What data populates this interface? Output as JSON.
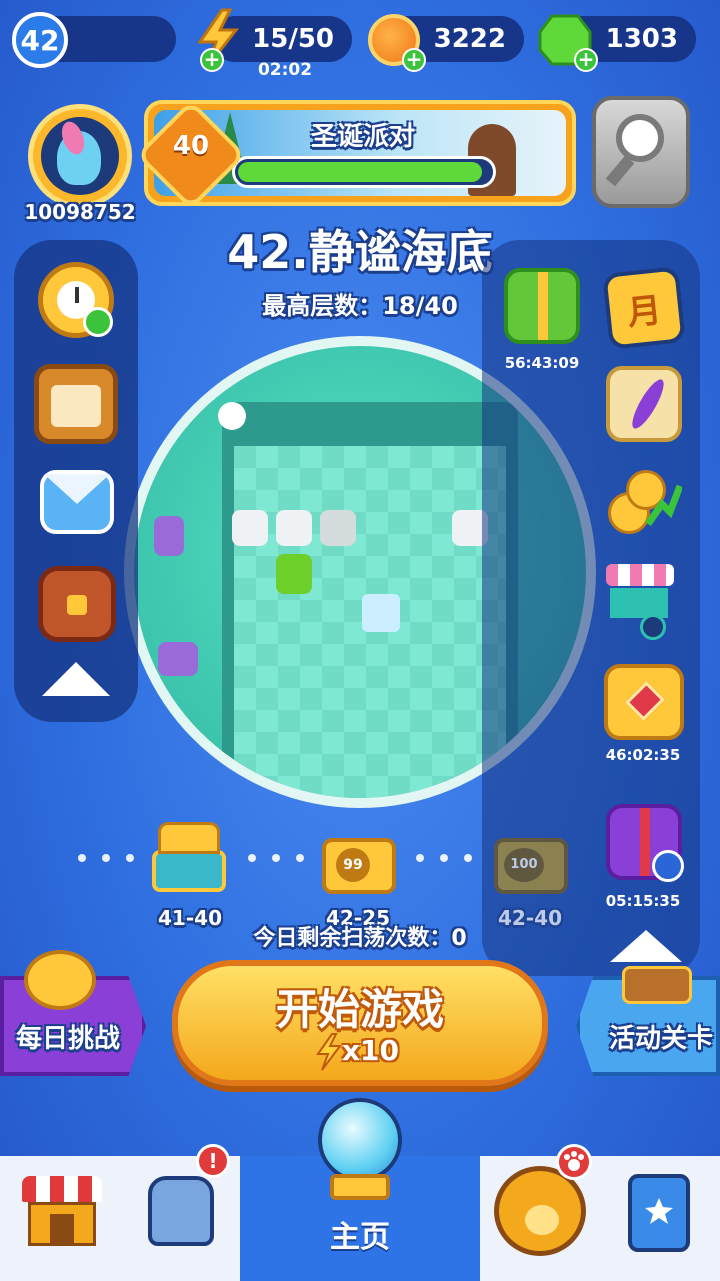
{
  "status_bar": {
    "player_level": "42",
    "energy": "15/50",
    "energy_timer": "02:02",
    "coins": "3222",
    "gems": "1303"
  },
  "player": {
    "id": "10098752"
  },
  "event_banner": {
    "level": "40",
    "title": "圣诞派对",
    "progress": 0.95
  },
  "stage": {
    "title": "42.静谧海底",
    "best_floor": "最高层数：18/40"
  },
  "left_menu": {
    "items": [
      "speed-up-stopwatch",
      "pet-board",
      "mail",
      "backpack"
    ]
  },
  "right_menu": {
    "gift_timer": "56:43:09",
    "monthly_label": "月",
    "chest_timer": "46:02:35",
    "gift_box_timer": "05:15:35"
  },
  "rewards": {
    "chests": [
      {
        "label": "41-40",
        "badge": ""
      },
      {
        "label": "42-25",
        "badge": "99"
      },
      {
        "label": "42-40",
        "badge": "100"
      }
    ],
    "sweeps_remaining": "今日剩余扫荡次数：0"
  },
  "buttons": {
    "daily_challenge": "每日挑战",
    "start_game": "开始游戏",
    "start_cost": "x10",
    "event_stage": "活动关卡"
  },
  "bottom_nav": {
    "home_label": "主页",
    "equipment_badge": "!",
    "pets_badge": "paw"
  },
  "colors": {
    "accent_yellow": "#ffc83a",
    "panel_blue": "#17368a",
    "start_orange": "#f4a81c",
    "daily_purple": "#8a3fd6"
  }
}
